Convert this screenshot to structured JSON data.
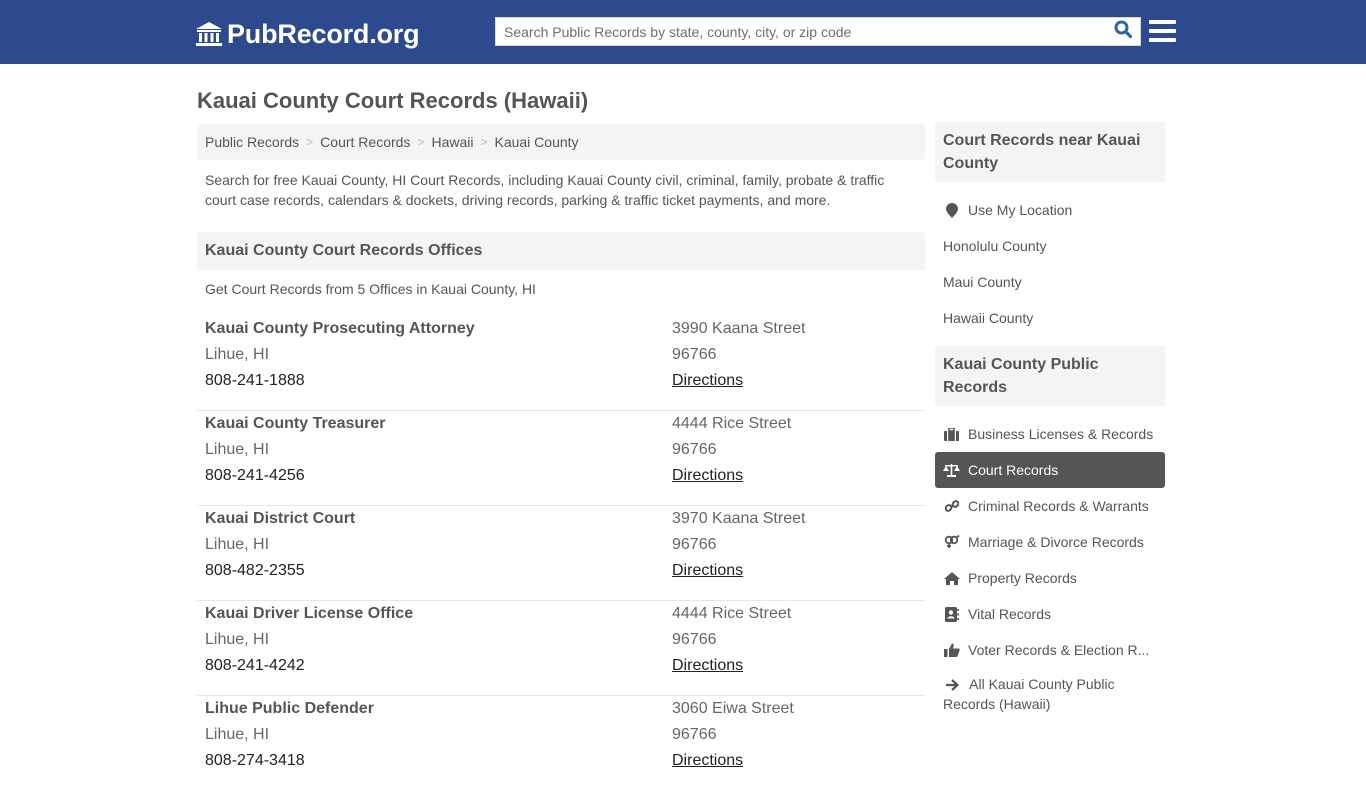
{
  "header": {
    "logo_text": "PubRecord.org",
    "logo_icon": "institution-icon",
    "search_placeholder": "Search Public Records by state, county, city, or zip code",
    "search_value": "",
    "search_icon": "search-icon",
    "menu_icon": "hamburger-menu-icon",
    "brand_color": "#2e4a8f"
  },
  "page": {
    "title": "Kauai County Court Records (Hawaii)",
    "breadcrumb": [
      "Public Records",
      "Court Records",
      "Hawaii",
      "Kauai County"
    ],
    "intro": "Search for free Kauai County, HI Court Records, including Kauai County civil, criminal, family, probate & traffic court case records, calendars & dockets, driving records, parking & traffic ticket payments, and more.",
    "section_title": "Kauai County Court Records Offices",
    "section_subtext": "Get Court Records from 5 Offices in Kauai County, HI"
  },
  "offices": [
    {
      "name": "Kauai County Prosecuting Attorney",
      "city": "Lihue, HI",
      "phone": "808-241-1888",
      "address": "3990 Kaana Street",
      "zip": "96766",
      "directions": "Directions"
    },
    {
      "name": "Kauai County Treasurer",
      "city": "Lihue, HI",
      "phone": "808-241-4256",
      "address": "4444 Rice Street",
      "zip": "96766",
      "directions": "Directions"
    },
    {
      "name": "Kauai District Court",
      "city": "Lihue, HI",
      "phone": "808-482-2355",
      "address": "3970 Kaana Street",
      "zip": "96766",
      "directions": "Directions"
    },
    {
      "name": "Kauai Driver License Office",
      "city": "Lihue, HI",
      "phone": "808-241-4242",
      "address": "4444 Rice Street",
      "zip": "96766",
      "directions": "Directions"
    },
    {
      "name": "Lihue Public Defender",
      "city": "Lihue, HI",
      "phone": "808-274-3418",
      "address": "3060 Eiwa Street",
      "zip": "96766",
      "directions": "Directions"
    }
  ],
  "sidebar": {
    "nearby_title": "Court Records near Kauai County",
    "nearby_items": [
      {
        "label": "Use My Location",
        "icon": "map-marker-icon"
      },
      {
        "label": "Honolulu County"
      },
      {
        "label": "Maui County"
      },
      {
        "label": "Hawaii County"
      }
    ],
    "public_title": "Kauai County Public Records",
    "public_items": [
      {
        "label": "Business Licenses & Records",
        "icon": "briefcase-icon",
        "active": false
      },
      {
        "label": "Court Records",
        "icon": "balance-scale-icon",
        "active": true
      },
      {
        "label": "Criminal Records & Warrants",
        "icon": "link-icon",
        "active": false
      },
      {
        "label": "Marriage & Divorce Records",
        "icon": "venus-mars-icon",
        "active": false
      },
      {
        "label": "Property Records",
        "icon": "home-icon",
        "active": false
      },
      {
        "label": "Vital Records",
        "icon": "address-book-icon",
        "active": false
      },
      {
        "label": "Voter Records & Election R...",
        "icon": "thumbs-up-icon",
        "active": false
      }
    ],
    "all_link": "All Kauai County Public Records (Hawaii)",
    "all_link_icon": "arrow-right-icon",
    "active_color": "#555555"
  }
}
